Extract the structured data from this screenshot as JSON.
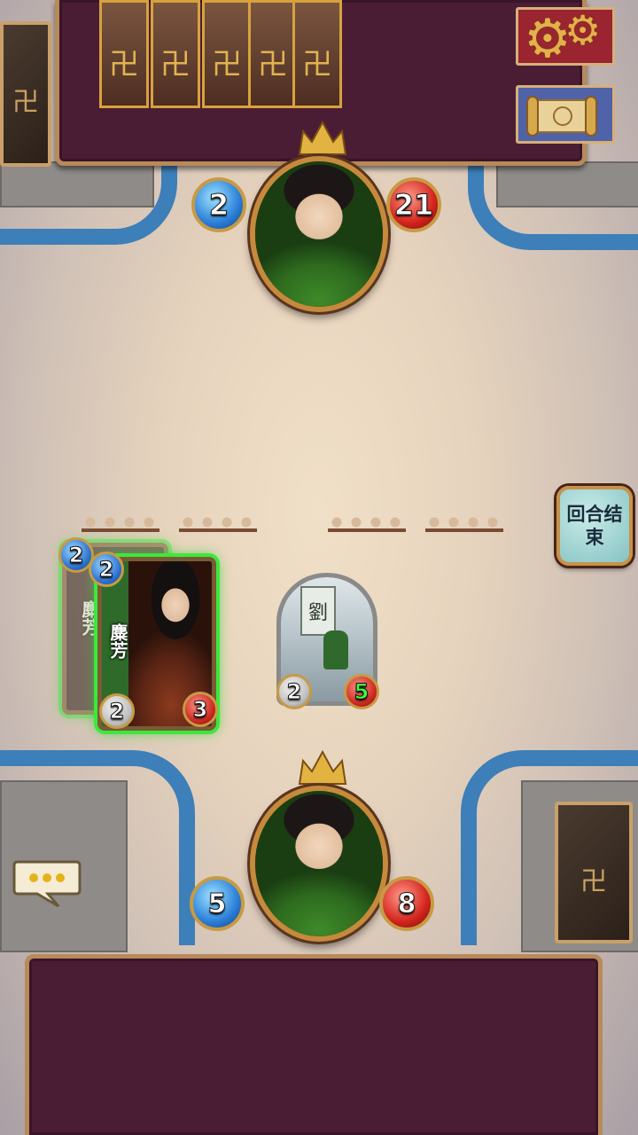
{
  "enemy_hero": {
    "mana": "2",
    "health": "21"
  },
  "player_hero": {
    "mana": "5",
    "health": "8"
  },
  "end_turn": {
    "label": "回合结束"
  },
  "enemy_hand": {
    "count": 5,
    "card_glyph": "卍"
  },
  "board_cards": [
    {
      "name": "麋芳",
      "cost": "2",
      "attack": "2",
      "health": "3",
      "playable": true
    },
    {
      "name": "麋芳",
      "cost": "2",
      "attack": "",
      "health": "",
      "playable": true
    }
  ],
  "player_minion": {
    "banner": "劉",
    "attack": "2",
    "health": "5"
  },
  "colors": {
    "panel": "#4a1d35",
    "frame_gold": "#c58a3b",
    "mana_blue": "#2a7fd8",
    "health_red": "#d3241c",
    "playable_glow": "#3ce83c",
    "water": "#3d7fb8"
  },
  "icons": {
    "settings": "gear-icon",
    "log": "scroll-icon",
    "chat": "chat-bubble-icon"
  }
}
